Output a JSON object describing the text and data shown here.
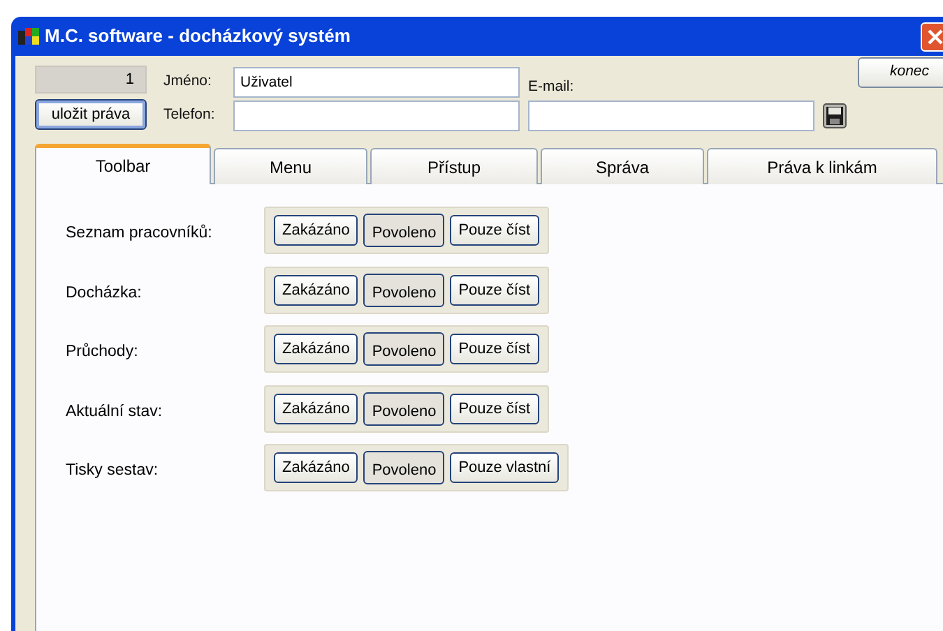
{
  "window": {
    "title": "M.C. software - docházkový systém"
  },
  "record_number": "1",
  "save_button": "uložit práva",
  "exit_button": "konec",
  "name_field": {
    "label": "Jméno:",
    "value": "Uživatel"
  },
  "phone_field": {
    "label": "Telefon:"
  },
  "email_field": {
    "label": "E-mail:"
  },
  "tabs": [
    {
      "label": "Toolbar",
      "selected": true
    },
    {
      "label": "Menu",
      "selected": false
    },
    {
      "label": "Přístup",
      "selected": false
    },
    {
      "label": "Správa",
      "selected": false
    },
    {
      "label": "Práva k linkám",
      "selected": false
    }
  ],
  "permissions": [
    {
      "label": "Seznam pracovníků:",
      "options": [
        {
          "label": "Zakázáno",
          "selected": false
        },
        {
          "label": "Povoleno",
          "selected": true
        },
        {
          "label": "Pouze číst",
          "selected": false
        }
      ]
    },
    {
      "label": "Docházka:",
      "options": [
        {
          "label": "Zakázáno",
          "selected": false
        },
        {
          "label": "Povoleno",
          "selected": true
        },
        {
          "label": "Pouze číst",
          "selected": false
        }
      ]
    },
    {
      "label": "Průchody:",
      "options": [
        {
          "label": "Zakázáno",
          "selected": false
        },
        {
          "label": "Povoleno",
          "selected": true
        },
        {
          "label": "Pouze číst",
          "selected": false
        }
      ]
    },
    {
      "label": "Aktuální stav:",
      "options": [
        {
          "label": "Zakázáno",
          "selected": false
        },
        {
          "label": "Povoleno",
          "selected": true
        },
        {
          "label": "Pouze číst",
          "selected": false
        }
      ]
    },
    {
      "label": "Tisky sestav:",
      "options": [
        {
          "label": "Zakázáno",
          "selected": false
        },
        {
          "label": "Povoleno",
          "selected": true
        },
        {
          "label": "Pouze vlastní",
          "selected": false
        }
      ]
    }
  ]
}
